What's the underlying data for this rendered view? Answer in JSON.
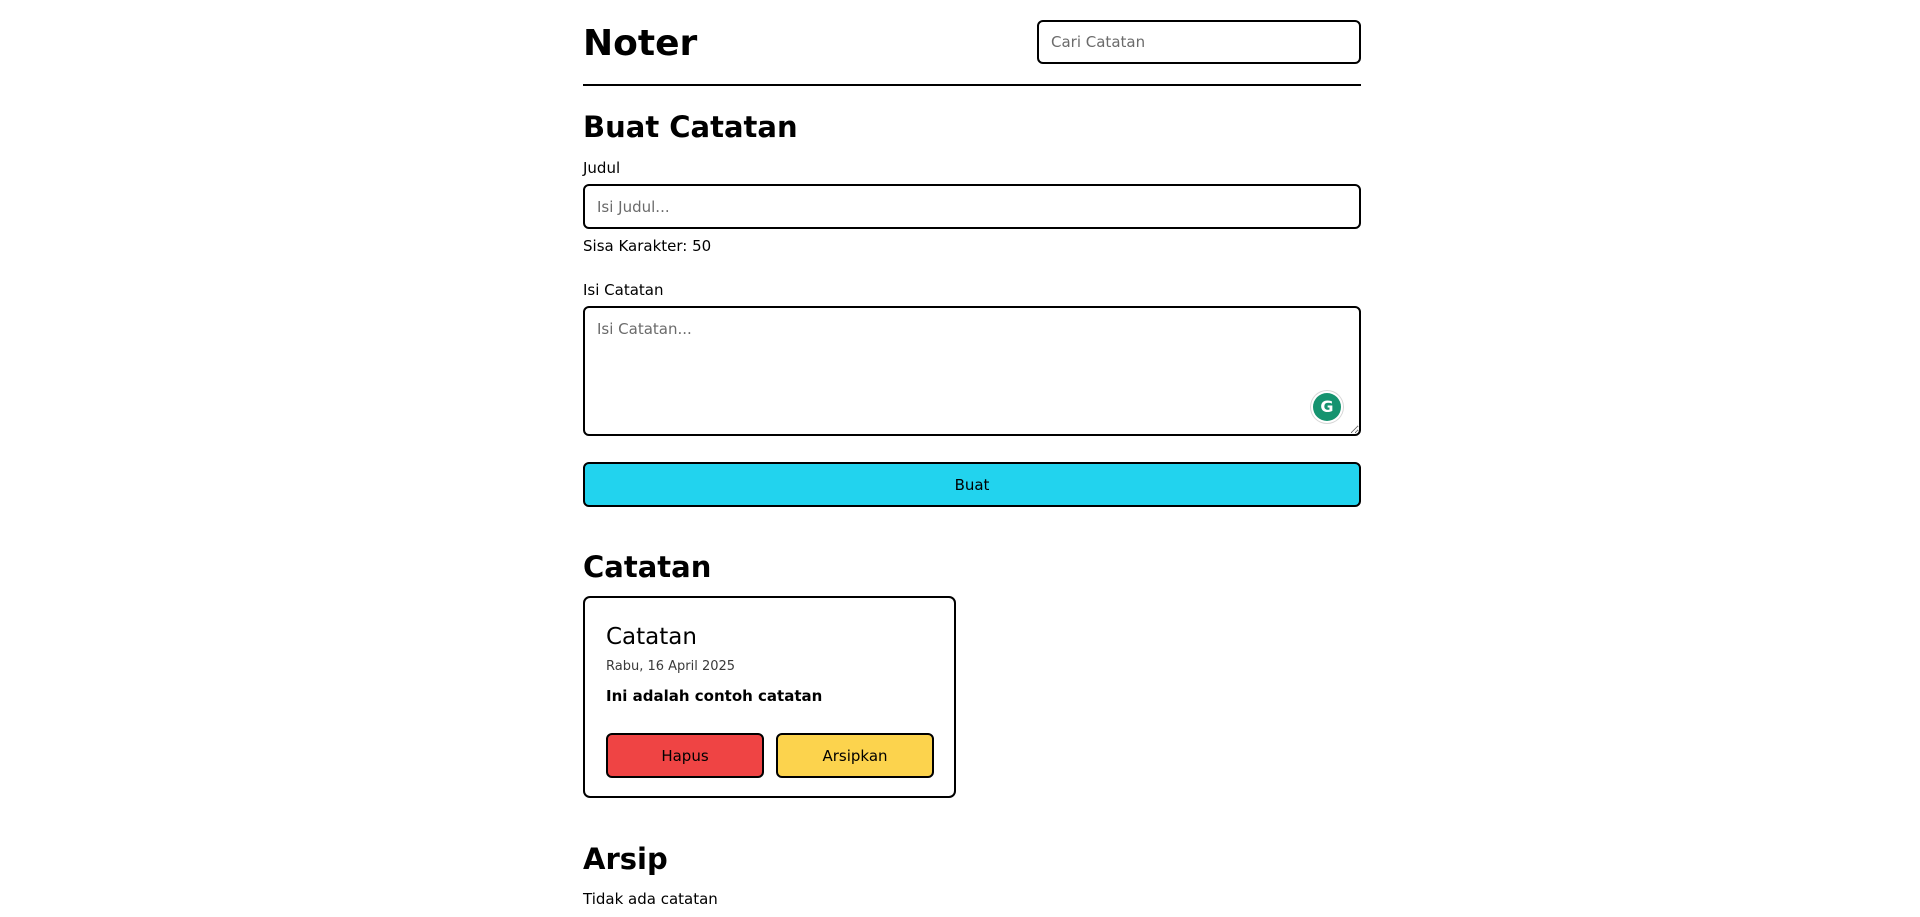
{
  "header": {
    "app_title": "Noter",
    "search_placeholder": "Cari Catatan"
  },
  "create_form": {
    "heading": "Buat Catatan",
    "title_label": "Judul",
    "title_placeholder": "Isi Judul...",
    "char_remaining": "Sisa Karakter: 50",
    "body_label": "Isi Catatan",
    "body_placeholder": "Isi Catatan...",
    "submit_label": "Buat",
    "grammarly_icon": "G",
    "accent_color": "#22d3ee"
  },
  "notes_section": {
    "heading": "Catatan",
    "notes": [
      {
        "title": "Catatan",
        "date": "Rabu, 16 April 2025",
        "body": "Ini adalah contoh catatan",
        "delete_label": "Hapus",
        "archive_label": "Arsipkan"
      }
    ],
    "delete_color": "#ef4444",
    "archive_color": "#fcd34d"
  },
  "archive_section": {
    "heading": "Arsip",
    "empty_text": "Tidak ada catatan"
  }
}
